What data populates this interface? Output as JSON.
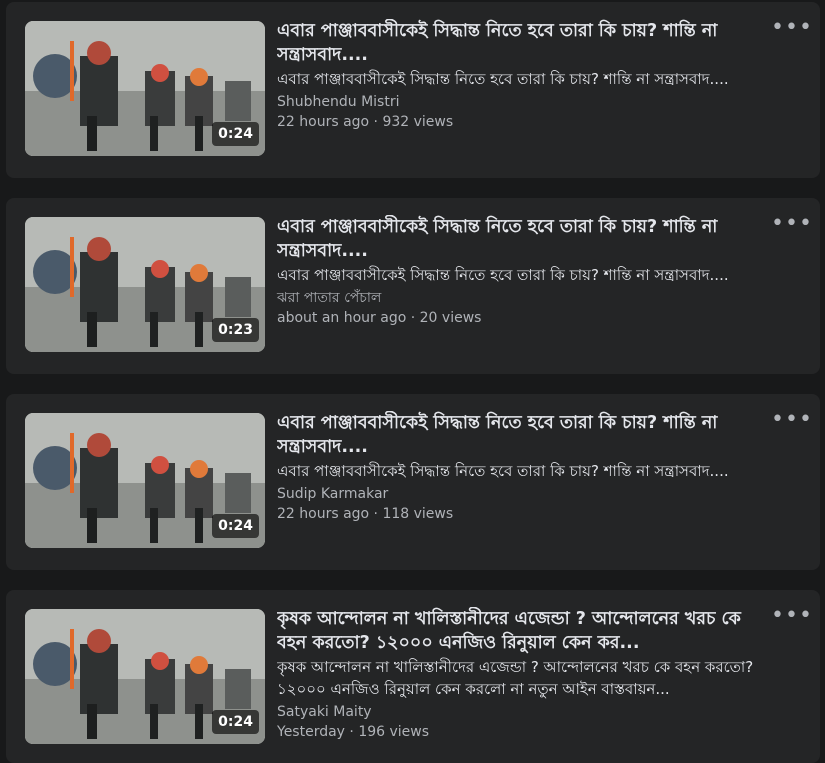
{
  "videos": [
    {
      "title": "এবার পাঞ্জাববাসীকেই সিদ্ধান্ত নিতে হবে তারা কি চায়? শান্তি না সন্ত্রাসবাদ....",
      "description": "এবার পাঞ্জাববাসীকেই সিদ্ধান্ত নিতে হবে তারা কি চায়? শান্তি না সন্ত্রাসবাদ....",
      "author": "Shubhendu Mistri",
      "meta": "22 hours ago · 932 views",
      "duration": "0:24",
      "more_icon": "more-horizontal-icon"
    },
    {
      "title": "এবার পাঞ্জাববাসীকেই সিদ্ধান্ত নিতে হবে তারা কি চায়? শান্তি না সন্ত্রাসবাদ....",
      "description": "এবার পাঞ্জাববাসীকেই সিদ্ধান্ত নিতে হবে তারা কি চায়? শান্তি না সন্ত্রাসবাদ....",
      "author": "ঝরা পাতার পেঁচাল",
      "meta": "about an hour ago · 20 views",
      "duration": "0:23",
      "more_icon": "more-horizontal-icon"
    },
    {
      "title": "এবার পাঞ্জাববাসীকেই সিদ্ধান্ত নিতে হবে তারা কি চায়? শান্তি না সন্ত্রাসবাদ....",
      "description": "এবার পাঞ্জাববাসীকেই সিদ্ধান্ত নিতে হবে তারা কি চায়? শান্তি না সন্ত্রাসবাদ....",
      "author": "Sudip Karmakar",
      "meta": "22 hours ago · 118 views",
      "duration": "0:24",
      "more_icon": "more-horizontal-icon"
    },
    {
      "title": "কৃষক আন্দোলন না খালিস্তানীদের এজেন্ডা ? আন্দোলনের খরচ কে বহন করতো? ১২০০০ এনজিও রিনুয়াল কেন কর...",
      "description": "কৃষক আন্দোলন না খালিস্তানীদের এজেন্ডা ? আন্দোলনের খরচ কে বহন করতো? ১২০০০ এনজিও রিনুয়াল কেন করলো না নতুন আইন বাস্তবায়ন...",
      "author": "Satyaki Maity",
      "meta": "Yesterday · 196 views",
      "duration": "0:24",
      "more_icon": "more-horizontal-icon"
    }
  ],
  "colors": {
    "page_bg": "#18191a",
    "card_bg": "#242526",
    "primary_text": "#e4e6eb",
    "secondary_text": "#b0b3b8"
  }
}
